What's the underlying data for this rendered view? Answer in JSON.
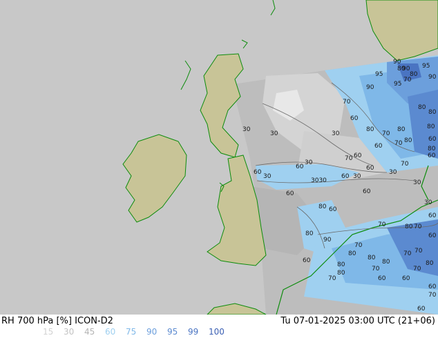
{
  "title_left": "RH 700 hPa [%] ICON-D2",
  "title_right": "Tu 07-01-2025 03:00 UTC (21+06)",
  "legend": {
    "values": [
      {
        "label": "15",
        "color": "#d2d2d2"
      },
      {
        "label": "30",
        "color": "#c3c3c3"
      },
      {
        "label": "45",
        "color": "#b4b4b4"
      },
      {
        "label": "60",
        "color": "#9fd0f0"
      },
      {
        "label": "75",
        "color": "#7fb8e8"
      },
      {
        "label": "90",
        "color": "#6c9fdc"
      },
      {
        "label": "95",
        "color": "#5b8ad0"
      },
      {
        "label": "99",
        "color": "#4a74c2"
      },
      {
        "label": "100",
        "color": "#3b5fb3"
      }
    ]
  },
  "contour_labels": [
    {
      "text": "90"
    },
    {
      "text": "90"
    },
    {
      "text": "95"
    },
    {
      "text": "80"
    },
    {
      "text": "95"
    },
    {
      "text": "80"
    },
    {
      "text": "90"
    },
    {
      "text": "95"
    },
    {
      "text": "70"
    },
    {
      "text": "90"
    },
    {
      "text": "70"
    },
    {
      "text": "80"
    },
    {
      "text": "80"
    },
    {
      "text": "60"
    },
    {
      "text": "30"
    },
    {
      "text": "30"
    },
    {
      "text": "30"
    },
    {
      "text": "80"
    },
    {
      "text": "70"
    },
    {
      "text": "80"
    },
    {
      "text": "80"
    },
    {
      "text": "60"
    },
    {
      "text": "70"
    },
    {
      "text": "80"
    },
    {
      "text": "60"
    },
    {
      "text": "80"
    },
    {
      "text": "70"
    },
    {
      "text": "60"
    },
    {
      "text": "60"
    },
    {
      "text": "30"
    },
    {
      "text": "70"
    },
    {
      "text": "60"
    },
    {
      "text": "60"
    },
    {
      "text": "30"
    },
    {
      "text": "3030"
    },
    {
      "text": "60"
    },
    {
      "text": "30"
    },
    {
      "text": "30"
    },
    {
      "text": "60"
    },
    {
      "text": "60"
    },
    {
      "text": "60"
    },
    {
      "text": "80"
    },
    {
      "text": "30"
    },
    {
      "text": "60"
    },
    {
      "text": "30"
    },
    {
      "text": "70"
    },
    {
      "text": "80"
    },
    {
      "text": "70"
    },
    {
      "text": "80"
    },
    {
      "text": "90"
    },
    {
      "text": "70"
    },
    {
      "text": "60"
    },
    {
      "text": "60"
    },
    {
      "text": "80"
    },
    {
      "text": "70"
    },
    {
      "text": "80"
    },
    {
      "text": "80"
    },
    {
      "text": "70"
    },
    {
      "text": "60"
    },
    {
      "text": "70"
    },
    {
      "text": "80"
    },
    {
      "text": "70"
    },
    {
      "text": "80"
    },
    {
      "text": "60"
    },
    {
      "text": "80"
    },
    {
      "text": "60"
    },
    {
      "text": "70"
    },
    {
      "text": "70"
    },
    {
      "text": "60"
    },
    {
      "text": "60"
    }
  ]
}
